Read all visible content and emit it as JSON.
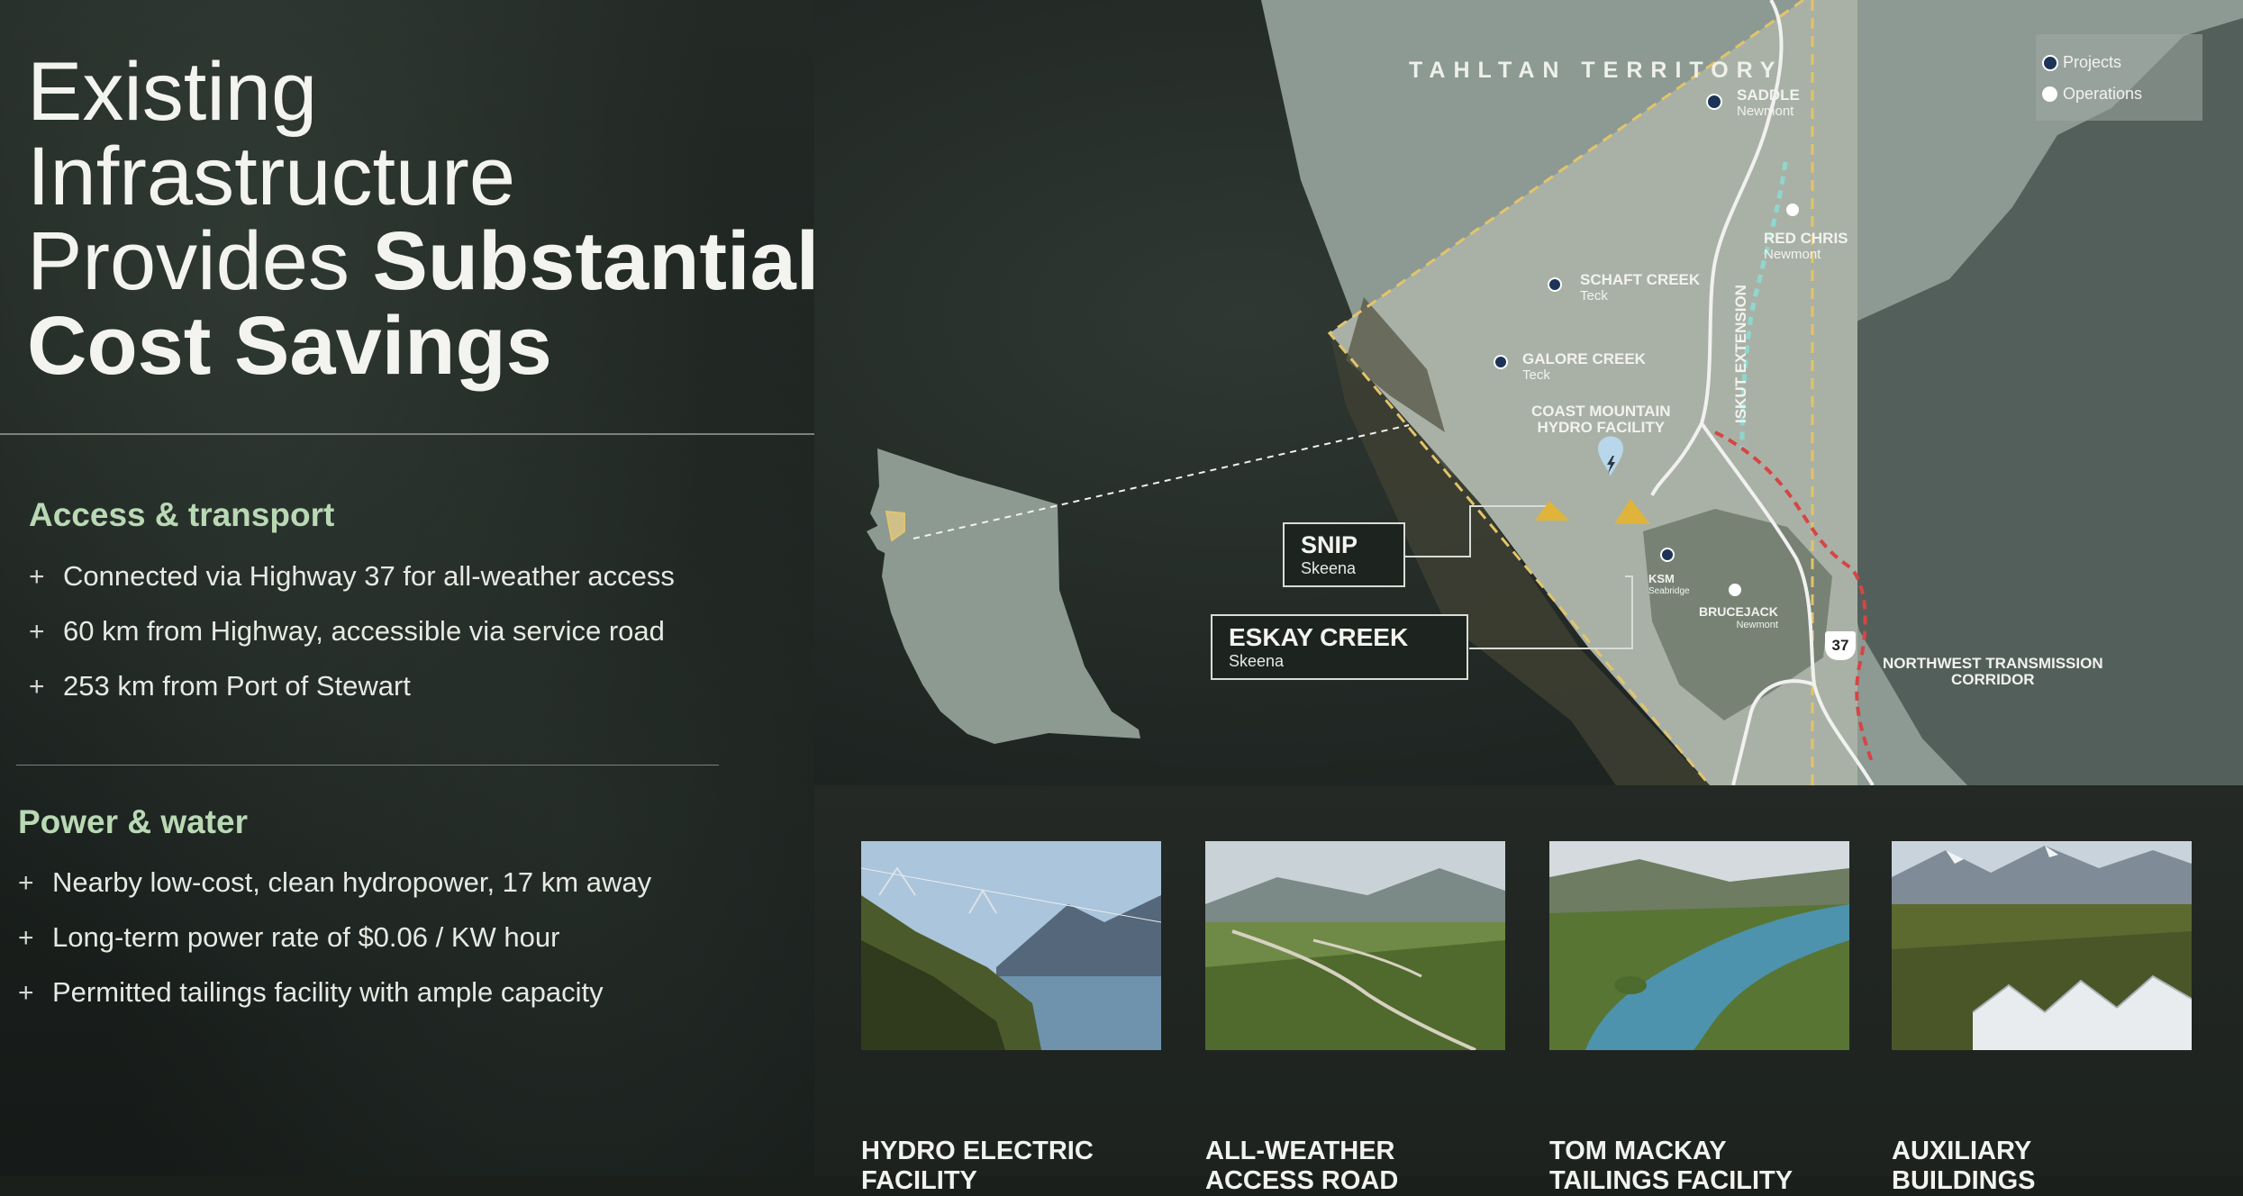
{
  "title": {
    "line1": "Existing",
    "line2": "Infrastructure",
    "line3_light": "Provides ",
    "line3_bold": "Substantial",
    "line4": "Cost Savings"
  },
  "access": {
    "heading": "Access & transport",
    "bullets": [
      "Connected via Highway 37 for all-weather access",
      "60 km from Highway, accessible via service road",
      "253 km from Port of Stewart"
    ]
  },
  "power": {
    "heading": "Power & water",
    "bullets": [
      "Nearby low-cost, clean hydropower, 17 km away",
      "Long-term power rate of $0.06 / KW hour",
      "Permitted tailings facility with ample capacity"
    ]
  },
  "bullet_symbol": "+",
  "map": {
    "territory": "TAHLTAN TERRITORY",
    "legend": {
      "projects": "Projects",
      "operations": "Operations",
      "projects_color": "#1d3357",
      "operations_color": "#ffffff"
    },
    "sites": {
      "saddle": {
        "name": "SADDLE",
        "owner": "Newmont"
      },
      "red_chris": {
        "name": "RED CHRIS",
        "owner": "Newmont"
      },
      "schaft_creek": {
        "name": "SCHAFT CREEK",
        "owner": "Teck"
      },
      "galore_creek": {
        "name": "GALORE CREEK",
        "owner": "Teck"
      },
      "ksm": {
        "name": "KSM",
        "owner": "Seabridge"
      },
      "brucejack": {
        "name": "BRUCEJACK",
        "owner": "Newmont"
      }
    },
    "hydro": {
      "line1": "COAST MOUNTAIN",
      "line2": "HYDRO FACILITY"
    },
    "iskut": "ISKUT EXTENSION",
    "corridor": {
      "line1": "NORTHWEST TRANSMISSION",
      "line2": "CORRIDOR"
    },
    "highway": "37",
    "snip": {
      "name": "SNIP",
      "owner": "Skeena"
    },
    "eskay": {
      "name": "ESKAY CREEK",
      "owner": "Skeena"
    }
  },
  "photos": [
    {
      "icon": "hydro-electric-photo",
      "line1": "HYDRO ELECTRIC",
      "line2": "FACILITY"
    },
    {
      "icon": "access-road-photo",
      "line1": "ALL-WEATHER",
      "line2": "ACCESS ROAD"
    },
    {
      "icon": "tailings-lake-photo",
      "line1": "TOM MACKAY",
      "line2": "TAILINGS FACILITY"
    },
    {
      "icon": "buildings-photo",
      "line1": "AUXILIARY",
      "line2": "BUILDINGS"
    }
  ]
}
